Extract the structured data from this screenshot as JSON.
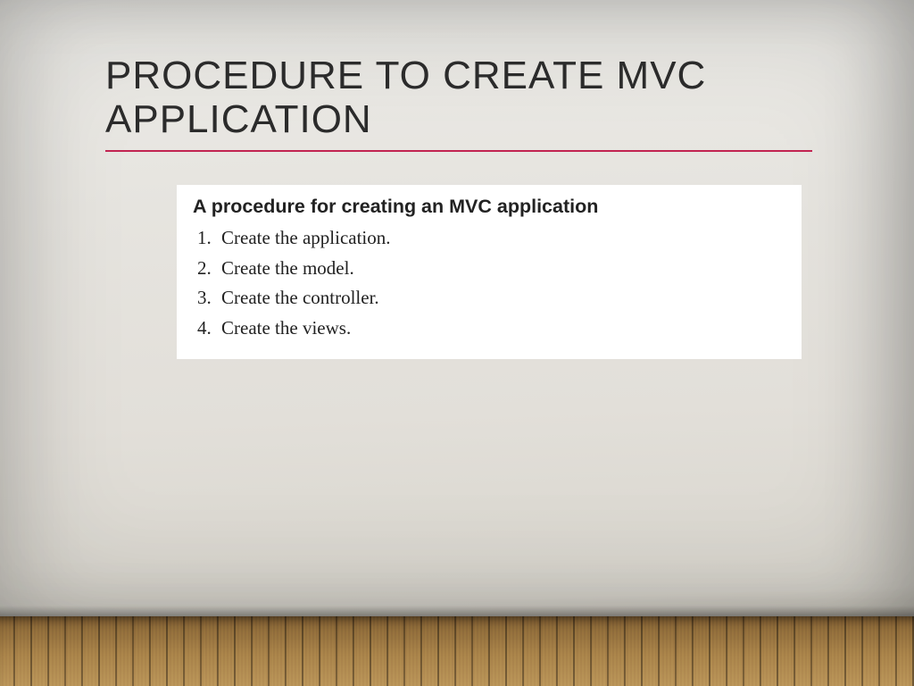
{
  "title": "PROCEDURE TO CREATE MVC APPLICATION",
  "card": {
    "heading": "A procedure for creating an MVC application",
    "steps": [
      "Create the application.",
      "Create the model.",
      "Create the controller.",
      "Create the views."
    ]
  },
  "colors": {
    "rule": "#c22451"
  }
}
